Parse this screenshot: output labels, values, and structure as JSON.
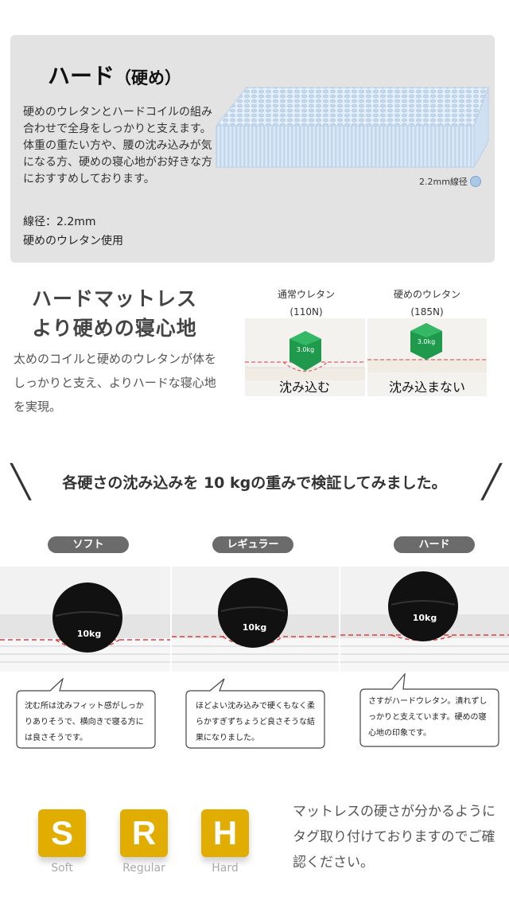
{
  "hard_section": {
    "title_main": "ハード",
    "title_sub": "（硬め）",
    "description": "硬めのウレタンとハードコイルの組み合わせで全身をしっかりと支えます。体重の重たい方や、腰の沈み込みが気になる方、硬めの寝心地がお好きな方におすすめしております。",
    "spec_wire": "線径：2.2mm",
    "spec_urethane": "硬めのウレタン使用",
    "wire_label": "2.2mm線径",
    "wire_color": "#a9c8e6"
  },
  "hard_mattress": {
    "title_line1": "ハードマットレス",
    "title_line2": "より硬めの寝心地",
    "description": "太めのコイルと硬めのウレタンが体をしっかりと支え、よりハードな寝心地を実現。",
    "comparison": [
      {
        "label": "通常ウレタン",
        "value": "(110N)",
        "weight": "3.0kg",
        "caption": "沈み込む"
      },
      {
        "label": "硬めのウレタン",
        "value": "(185N)",
        "weight": "3.0kg",
        "caption": "沈み込まない"
      }
    ]
  },
  "test": {
    "heading": "各硬さの沈み込みを 10 kgの重みで検証してみました。",
    "slash_left": "╲",
    "slash_right": "╱",
    "ball_label": "10kg",
    "items": [
      {
        "name": "ソフト",
        "comment": "沈む所は沈みフィット感がしっかりありそうで、横向きで寝る方には良さそうです。"
      },
      {
        "name": "レギュラー",
        "comment": "ほどよい沈み込みで硬くもなく柔らかすぎずちょうど良さそうな結果になりました。"
      },
      {
        "name": "ハード",
        "comment": "さすがハードウレタン。潰れずしっかりと支えています。硬めの寝心地の印象です。"
      }
    ]
  },
  "tags": {
    "items": [
      {
        "letter": "S",
        "label": "Soft"
      },
      {
        "letter": "R",
        "label": "Regular"
      },
      {
        "letter": "H",
        "label": "Hard"
      }
    ],
    "color": "#e0ad00",
    "note": "マットレスの硬さが分かるようにタグ取り付けておりますのでご確認ください。"
  }
}
